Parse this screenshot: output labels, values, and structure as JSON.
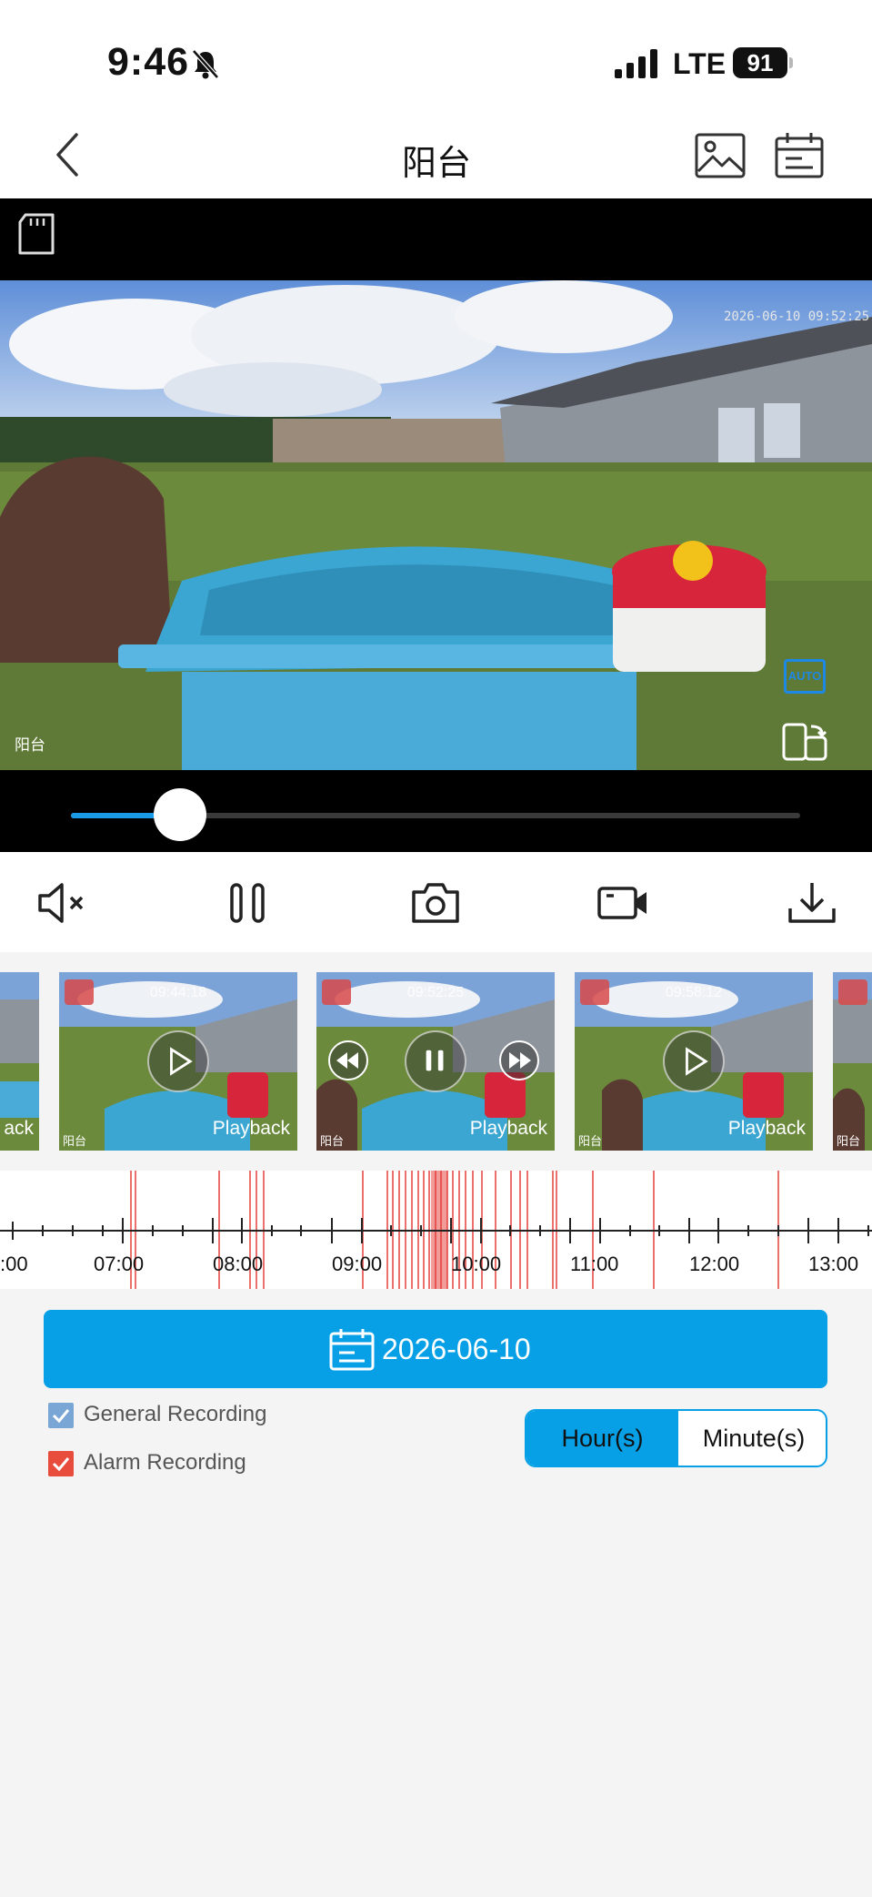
{
  "status_bar": {
    "time": "9:46",
    "network": "LTE",
    "battery": "91"
  },
  "header": {
    "title": "阳台",
    "back_icon": "chevron-left-icon",
    "gallery_icon": "image-icon",
    "calendar_icon": "calendar-icon"
  },
  "video": {
    "timestamp": "2026-06-10 09:52:25",
    "camera_label": "阳台",
    "auto_badge": "AUTO",
    "playback_progress_pct": 15
  },
  "controls": [
    {
      "name": "mute-icon"
    },
    {
      "name": "pause-icon"
    },
    {
      "name": "snapshot-icon"
    },
    {
      "name": "record-icon"
    },
    {
      "name": "download-icon"
    }
  ],
  "clips": [
    {
      "time": "",
      "caption": "ack",
      "location": ""
    },
    {
      "time": "09:44:18",
      "caption": "Playback",
      "location": "阳台"
    },
    {
      "time": "09:52:25",
      "caption": "Playback",
      "location": "阳台"
    },
    {
      "time": "09:58:12",
      "caption": "Playback",
      "location": "阳台"
    },
    {
      "time": "",
      "caption": "",
      "location": "阳台"
    }
  ],
  "timeline": {
    "labels": [
      ":00",
      "07:00",
      "08:00",
      "09:00",
      "10:00",
      "11:00",
      "12:00",
      "13:00"
    ],
    "colors": {
      "event": "#e53935",
      "axis": "#222222"
    }
  },
  "date_button": {
    "label": "2026-06-10"
  },
  "filters": {
    "general": "General Recording",
    "alarm": "Alarm Recording",
    "general_color": "#7aa6d6",
    "alarm_color": "#e74c3c"
  },
  "segmented": {
    "hours": "Hour(s)",
    "minutes": "Minute(s)",
    "selected": "Hour(s)",
    "accent": "#07a0e6"
  }
}
